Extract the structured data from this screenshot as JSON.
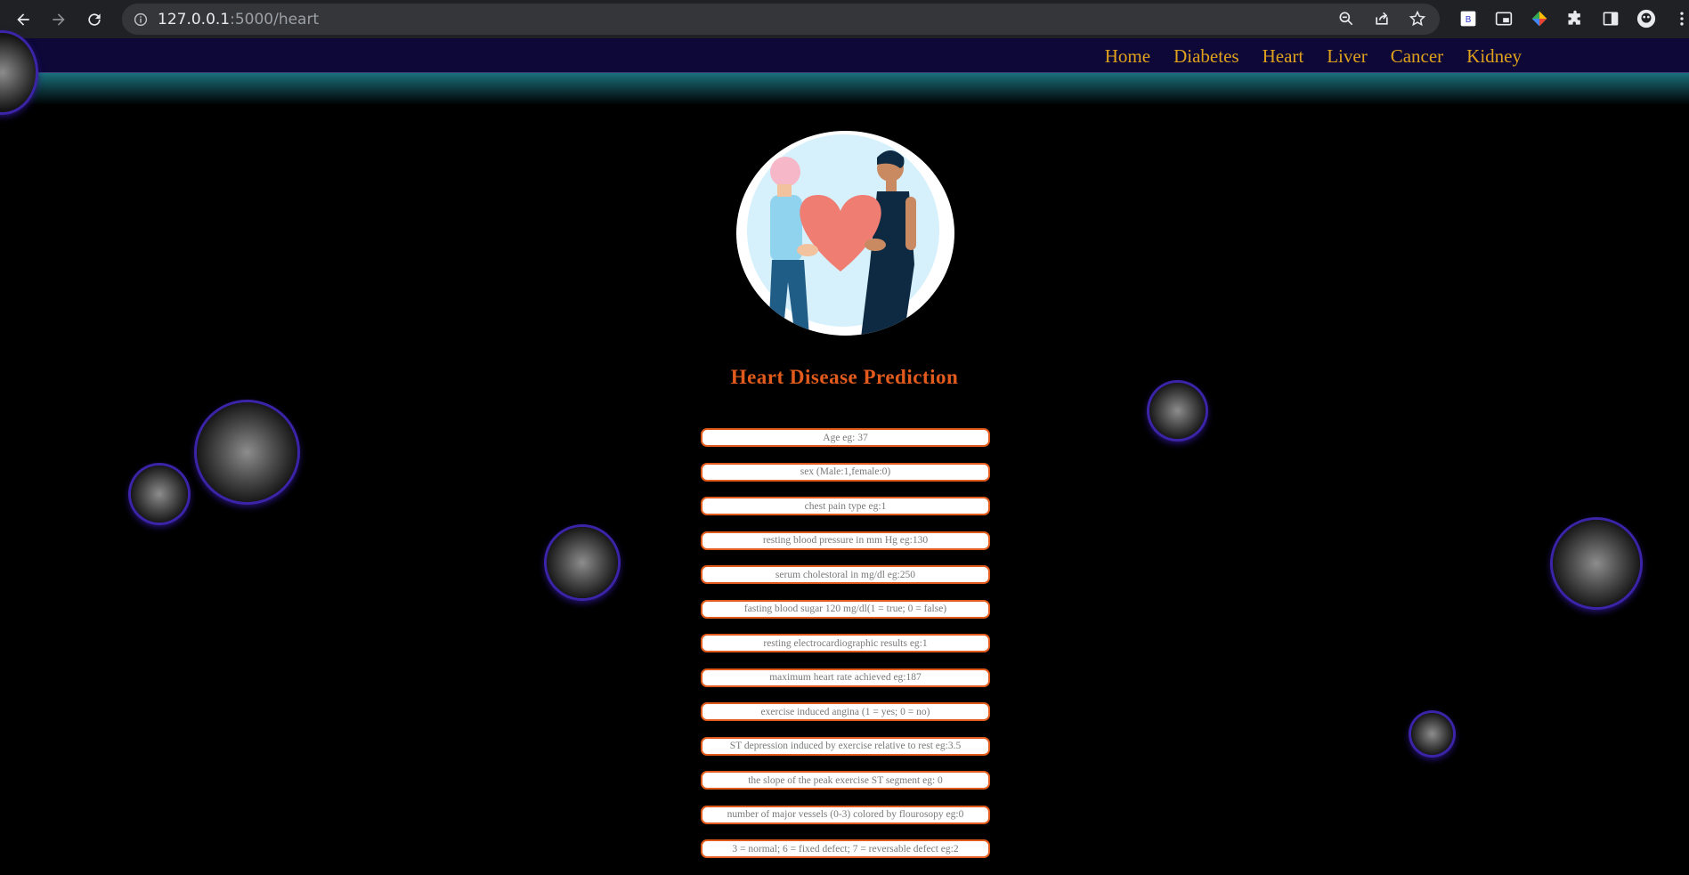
{
  "browser": {
    "url_host": "127.0.0.1",
    "url_path": ":5000/heart"
  },
  "nav": {
    "items": [
      "Home",
      "Diabetes",
      "Heart",
      "Liver",
      "Cancer",
      "Kidney"
    ]
  },
  "page": {
    "title": "Heart Disease Prediction"
  },
  "form": {
    "fields": [
      "Age eg: 37",
      "sex (Male:1,female:0)",
      "chest pain type eg:1",
      "resting blood pressure in mm Hg eg:130",
      "serum cholestoral in mg/dl eg:250",
      "fasting blood sugar 120 mg/dl(1 = true; 0 = false)",
      "resting electrocardiographic results eg:1",
      "maximum heart rate achieved eg:187",
      "exercise induced angina (1 = yes; 0 = no)",
      "ST depression induced by exercise relative to rest eg:3.5",
      "the slope of the peak exercise ST segment eg: 0",
      "number of major vessels (0-3) colored by flourosopy eg:0",
      "3 = normal; 6 = fixed defect; 7 = reversable defect eg:2"
    ]
  },
  "colors": {
    "accent": "#e25b1c",
    "nav_link": "#e0a21c",
    "navbar_bg": "#0d0838",
    "bubble_ring": "#3b24a8"
  },
  "icons": [
    "back-arrow-icon",
    "forward-arrow-icon",
    "reload-icon",
    "info-icon",
    "zoom-icon",
    "share-icon",
    "star-icon",
    "extension-b-icon",
    "picture-in-picture-icon",
    "colorful-extension-icon",
    "puzzle-icon",
    "side-panel-icon",
    "profile-avatar-icon",
    "menu-dots-icon"
  ]
}
